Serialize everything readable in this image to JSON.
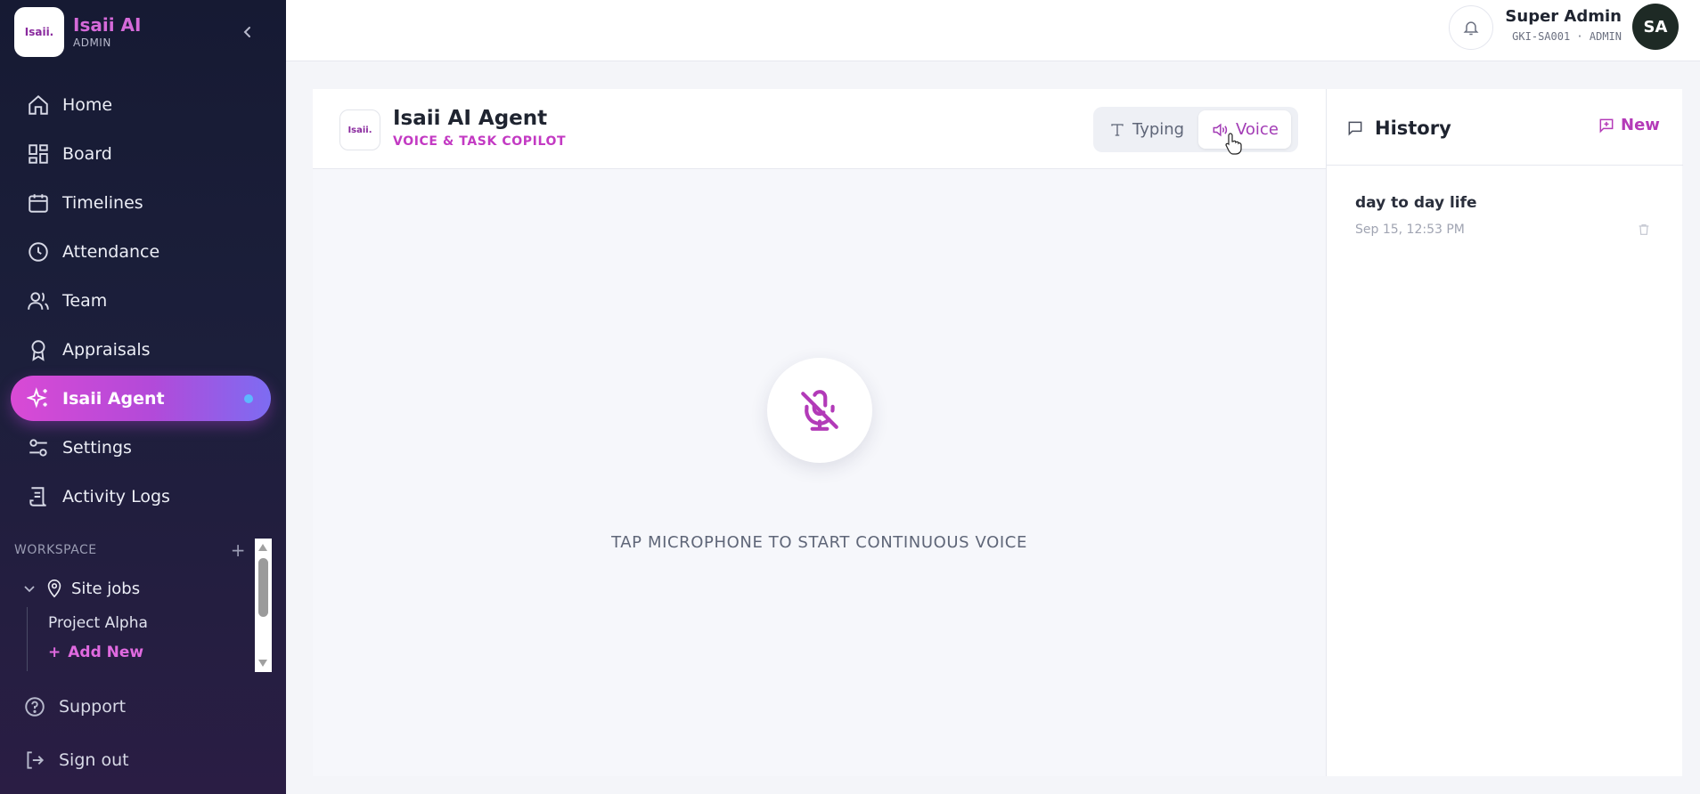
{
  "app": {
    "name": "Isaii AI",
    "role": "ADMIN",
    "logo_text": "Isaii.",
    "accent": "#d94ad5"
  },
  "nav": {
    "items": [
      {
        "label": "Home",
        "icon": "home-icon"
      },
      {
        "label": "Board",
        "icon": "board-icon"
      },
      {
        "label": "Timelines",
        "icon": "calendar-icon"
      },
      {
        "label": "Attendance",
        "icon": "clock-icon"
      },
      {
        "label": "Team",
        "icon": "team-icon"
      },
      {
        "label": "Appraisals",
        "icon": "award-icon"
      },
      {
        "label": "Isaii Agent",
        "icon": "sparkles-icon",
        "active": true
      },
      {
        "label": "Settings",
        "icon": "sliders-icon"
      },
      {
        "label": "Activity Logs",
        "icon": "logs-icon"
      }
    ]
  },
  "workspace": {
    "header": "WORKSPACE",
    "group": "Site jobs",
    "projects": [
      "Project Alpha"
    ],
    "add_label": "Add New"
  },
  "bottom": {
    "support": "Support",
    "signout": "Sign out"
  },
  "user": {
    "name": "Super Admin",
    "meta": "GKI-SA001 · ADMIN",
    "initials": "SA"
  },
  "agent": {
    "logo_text": "Isaii.",
    "title": "Isaii AI Agent",
    "subtitle": "VOICE & TASK COPILOT",
    "mode_typing": "Typing",
    "mode_voice": "Voice",
    "active_mode": "Voice",
    "caption": "TAP MICROPHONE TO START CONTINUOUS VOICE"
  },
  "history": {
    "title": "History",
    "new_label": "New",
    "items": [
      {
        "title": "day to day life",
        "date": "Sep 15, 12:53 PM"
      }
    ]
  }
}
